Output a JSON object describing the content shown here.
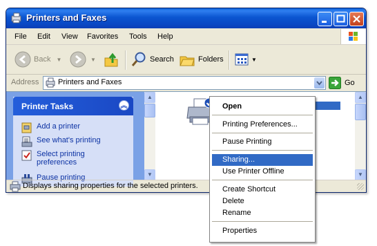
{
  "window": {
    "title": "Printers and Faxes"
  },
  "menu": {
    "items": [
      "File",
      "Edit",
      "View",
      "Favorites",
      "Tools",
      "Help"
    ]
  },
  "toolbar": {
    "back_label": "Back",
    "search_label": "Search",
    "folders_label": "Folders"
  },
  "address": {
    "label": "Address",
    "value": "Printers and Faxes",
    "go_label": "Go"
  },
  "tasks": {
    "title": "Printer Tasks",
    "items": [
      "Add a printer",
      "See what's printing",
      "Select printing preferences",
      "Pause printing"
    ]
  },
  "status": {
    "text": "Displays sharing properties for the selected printers."
  },
  "context_menu": {
    "items": [
      "Open",
      "Printing Preferences...",
      "Pause Printing",
      "Sharing...",
      "Use Printer Offline",
      "Create Shortcut",
      "Delete",
      "Rename",
      "Properties"
    ],
    "highlighted": "Sharing..."
  },
  "colors": {
    "titlebar": "#0a48c4",
    "highlight": "#316ac5",
    "task_link": "#0c32a3"
  }
}
